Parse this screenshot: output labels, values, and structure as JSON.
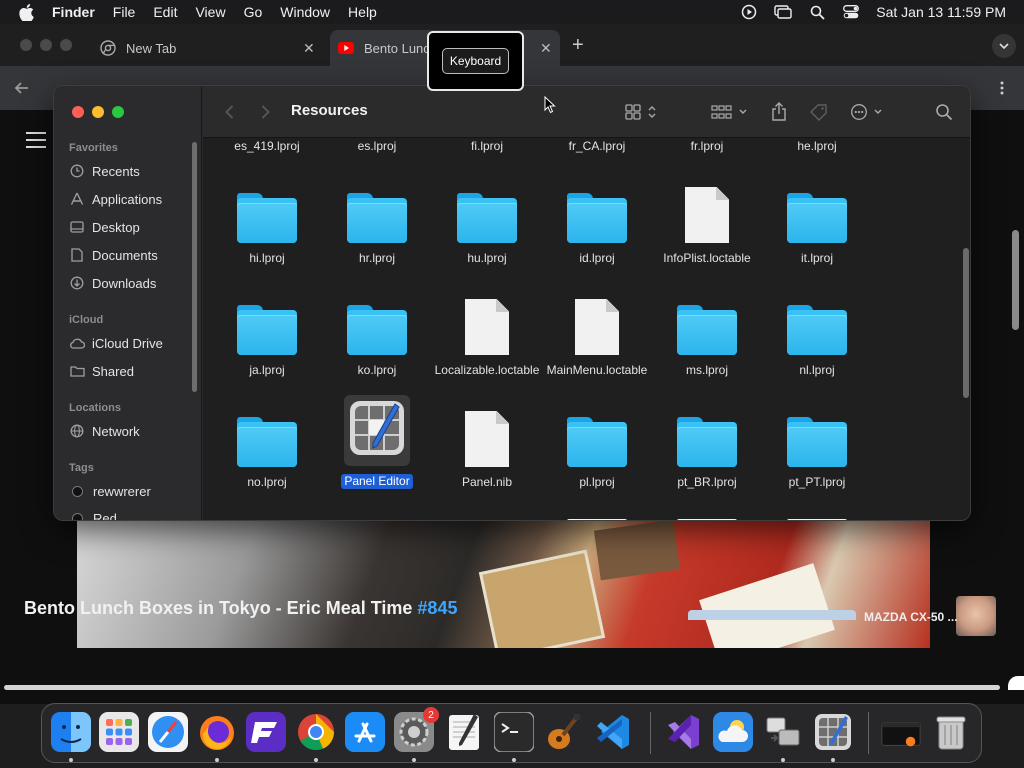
{
  "menubar": {
    "app_name": "Finder",
    "items": [
      "File",
      "Edit",
      "View",
      "Go",
      "Window",
      "Help"
    ],
    "clock": "Sat Jan 13  11:59 PM",
    "tray_icons": [
      "play-circle-icon",
      "screen-mirror-icon",
      "search-icon",
      "control-center-icon"
    ]
  },
  "browser": {
    "tabs": [
      {
        "label": "New Tab",
        "icon": "chrome-icon"
      },
      {
        "label": "Bento Lunc",
        "icon": "youtube-icon"
      }
    ],
    "video": {
      "title": "Bento Lunch Boxes in Tokyo - Eric Meal Time",
      "tag": "#845",
      "side_title": "MAZDA CX-50 ..."
    }
  },
  "keyboard_overlay": {
    "label": "Keyboard"
  },
  "finder": {
    "title": "Resources",
    "sidebar": {
      "favorites_label": "Favorites",
      "favorites": [
        {
          "label": "Recents",
          "icon": "clock-icon"
        },
        {
          "label": "Applications",
          "icon": "applications-icon"
        },
        {
          "label": "Desktop",
          "icon": "desktop-icon"
        },
        {
          "label": "Documents",
          "icon": "document-icon"
        },
        {
          "label": "Downloads",
          "icon": "download-icon"
        }
      ],
      "icloud_label": "iCloud",
      "icloud": [
        {
          "label": "iCloud Drive",
          "icon": "cloud-icon"
        },
        {
          "label": "Shared",
          "icon": "shared-folder-icon"
        }
      ],
      "locations_label": "Locations",
      "locations": [
        {
          "label": "Network",
          "icon": "globe-icon"
        }
      ],
      "tags_label": "Tags",
      "tags": [
        {
          "label": "rewwrerer"
        },
        {
          "label": "Red"
        }
      ]
    },
    "rows": [
      [
        "es_419.lproj",
        "es.lproj",
        "fi.lproj",
        "fr_CA.lproj",
        "fr.lproj",
        "he.lproj"
      ],
      [
        "hi.lproj",
        "hr.lproj",
        "hu.lproj",
        "id.lproj",
        "InfoPlist.loctable",
        "it.lproj"
      ],
      [
        "ja.lproj",
        "ko.lproj",
        "Localizable.loctable",
        "MainMenu.loctable",
        "ms.lproj",
        "nl.lproj"
      ],
      [
        "no.lproj",
        "Panel Editor",
        "Panel.nib",
        "pl.lproj",
        "pt_BR.lproj",
        "pt_PT.lproj"
      ]
    ],
    "row_kinds": [
      [
        "none",
        "none",
        "none",
        "none",
        "none",
        "none"
      ],
      [
        "folder",
        "folder",
        "folder",
        "folder",
        "doc",
        "folder"
      ],
      [
        "folder",
        "folder",
        "doc",
        "doc",
        "folder",
        "folder"
      ],
      [
        "folder",
        "app",
        "doc",
        "folder",
        "folder",
        "folder"
      ]
    ],
    "selected": "Panel Editor"
  },
  "dock": {
    "apps": [
      {
        "name": "finder",
        "running": true
      },
      {
        "name": "launchpad",
        "running": false
      },
      {
        "name": "safari",
        "running": false
      },
      {
        "name": "firefox",
        "running": true
      },
      {
        "name": "fenix",
        "running": false
      },
      {
        "name": "chrome",
        "running": true
      },
      {
        "name": "app-store",
        "running": false
      },
      {
        "name": "system-settings",
        "running": true,
        "badge": "2"
      },
      {
        "name": "textedit",
        "running": false
      },
      {
        "name": "terminal",
        "running": true
      },
      {
        "name": "garageband",
        "running": false
      },
      {
        "name": "vscode",
        "running": false
      },
      {
        "name": "visual-studio",
        "running": false
      },
      {
        "name": "weather",
        "running": false
      },
      {
        "name": "migration-assistant",
        "running": true
      },
      {
        "name": "panel-editor",
        "running": true
      },
      {
        "name": "minimized-window",
        "running": false
      },
      {
        "name": "trash",
        "running": false
      }
    ]
  },
  "colors": {
    "selection": "#1f5fd6",
    "folder": "#2bb5ec",
    "link": "#3ea6ff",
    "close": "#ff5f57",
    "minimize": "#febc2e",
    "zoom": "#28c840"
  }
}
